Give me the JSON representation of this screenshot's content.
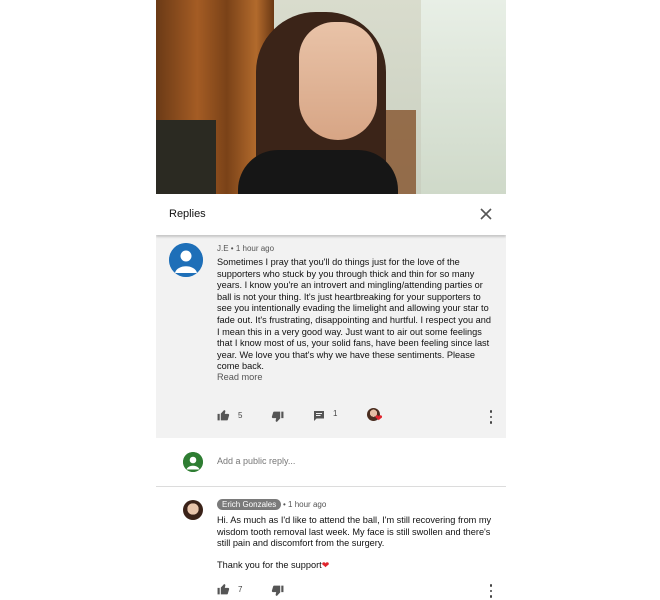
{
  "header": {
    "title": "Replies"
  },
  "comment": {
    "author": "J.E",
    "time": "1 hour ago",
    "text": "Sometimes I pray that you'll do things just for the love of the supporters who stuck by you through thick and thin for so many years. I know you're an introvert and mingling/attending parties or ball is not your thing. It's just heartbreaking for your supporters to see you intentionally evading the limelight and allowing your star to fade out. It's frustrating, disappointing and hurtful. I respect you and I mean this in a very good way. Just want to air out some feelings that I know most of us, your solid fans, have been feeling since last year. We love you that's why we have these sentiments. Please come back.",
    "read_more": "Read more",
    "likes": "5",
    "replies": "1"
  },
  "add_reply": {
    "placeholder": "Add a public reply..."
  },
  "reply": {
    "author": "Erich Gonzales",
    "time": "1 hour ago",
    "text": "Hi. As much as I'd like to attend the ball, I'm still recovering from my wisdom tooth removal last week. My face is still swollen and there's still pain and discomfort from the surgery.",
    "thanks": "Thank you for the support",
    "likes": "7"
  },
  "colors": {
    "heart": "#e0242c",
    "avatar_je": "#1e6fb8",
    "avatar_me": "#2e7d32",
    "comment_bg": "#f2f2f2"
  },
  "icons": [
    "close-icon",
    "thumbs-up-icon",
    "thumbs-down-icon",
    "reply-icon",
    "more-vert-icon",
    "heart-icon",
    "person-icon"
  ]
}
